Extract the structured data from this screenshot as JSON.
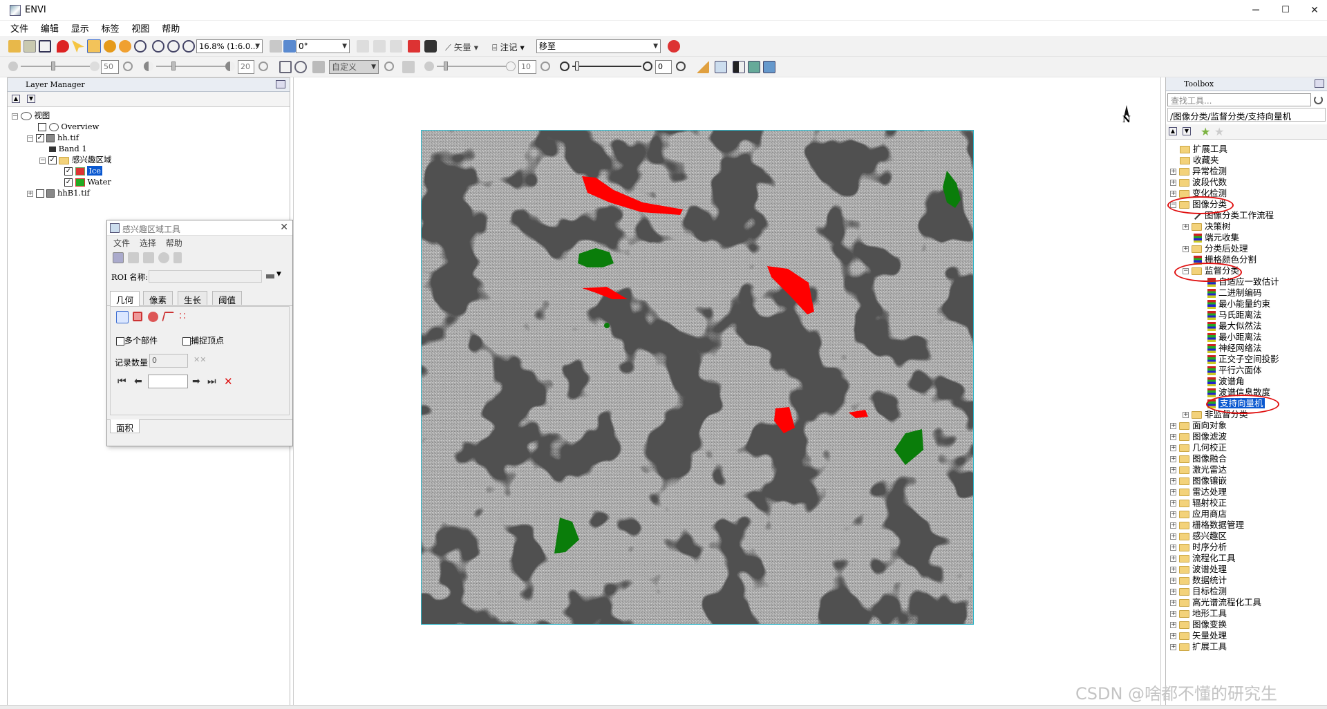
{
  "app": {
    "title": "ENVI",
    "min": "─",
    "max": "☐",
    "close": "✕"
  },
  "menu": [
    "文件",
    "编辑",
    "显示",
    "标签",
    "视图",
    "帮助"
  ],
  "toolbar1": {
    "zoom": "16.8% (1:6.0...",
    "rotation": "0°",
    "vector": "矢量",
    "annotation": "注记",
    "mode": "移至"
  },
  "toolbar2": {
    "brightness": "50",
    "contrast": "20",
    "stretch": "自定义",
    "transparency": "10",
    "sharpen": "0"
  },
  "layer_manager": {
    "title": "Layer Manager",
    "items": [
      {
        "label": "视图"
      },
      {
        "label": "Overview"
      },
      {
        "label": "hh.tif"
      },
      {
        "label": "Band 1"
      },
      {
        "label": "感兴趣区域"
      },
      {
        "label": "Ice"
      },
      {
        "label": "Water"
      },
      {
        "label": "hhB1.tif"
      }
    ]
  },
  "roi_tool": {
    "title": "感兴趣区域工具",
    "menu": [
      "文件",
      "选择",
      "帮助"
    ],
    "name_label": "ROI 名称:",
    "name_value": "",
    "tabs": [
      "几何",
      "像素",
      "生长",
      "阈值"
    ],
    "multi_part": "多个部件",
    "snap_vertex": "捕捉顶点",
    "record_label": "记录数量",
    "record_value": "0",
    "nav_value": "",
    "bottom_tab": "面积"
  },
  "north": "N",
  "toolbox": {
    "title": "Toolbox",
    "search_placeholder": "查找工具...",
    "path": "/图像分类/监督分类/支持向量机",
    "items": [
      "扩展工具",
      "收藏夹",
      "异常检测",
      "波段代数",
      "变化检测",
      "图像分类",
      "图像分类工作流程",
      "决策树",
      "端元收集",
      "分类后处理",
      "栅格颜色分割",
      "监督分类",
      "自适应一致估计",
      "二进制编码",
      "最小能量约束",
      "马氏距离法",
      "最大似然法",
      "最小距离法",
      "神经网络法",
      "正交子空间投影",
      "平行六面体",
      "波谱角",
      "波谱信息散度",
      "支持向量机",
      "非监督分类",
      "面向对象",
      "图像滤波",
      "几何校正",
      "图像融合",
      "激光雷达",
      "图像镶嵌",
      "雷达处理",
      "辐射校正",
      "应用商店",
      "栅格数据管理",
      "感兴趣区",
      "时序分析",
      "流程化工具",
      "波谱处理",
      "数据统计",
      "目标检测",
      "高光谱流程化工具",
      "地形工具",
      "图像变换",
      "矢量处理",
      "扩展工具"
    ]
  },
  "watermark": "CSDN @啥都不懂的研究生",
  "colors": {
    "roi_ice": "#ff0000",
    "roi_water": "#0a7d0a",
    "selection": "#0a58d0",
    "annotation": "#e01010"
  }
}
